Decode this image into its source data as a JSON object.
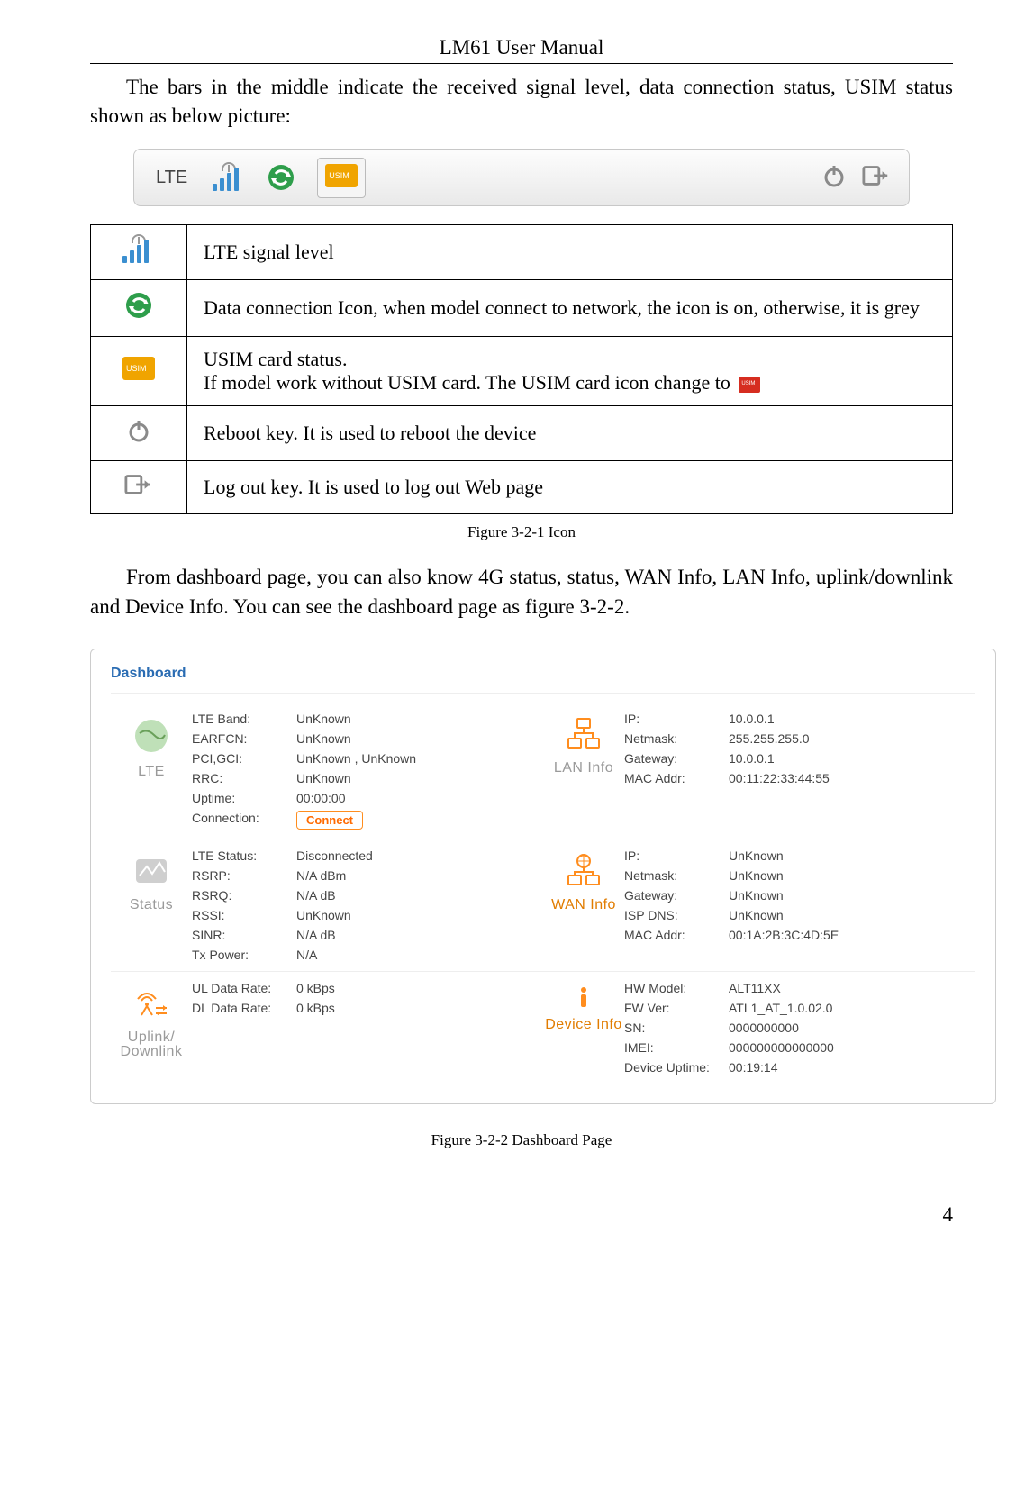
{
  "header": {
    "title": "LM61 User Manual"
  },
  "intro_paragraph": "The bars in the middle indicate the received signal level, data connection status, USIM status shown as below picture:",
  "statusbar": {
    "network_label": "LTE"
  },
  "icon_table": {
    "rows": [
      {
        "desc": "LTE signal level"
      },
      {
        "desc": "Data connection Icon, when model connect to network, the icon is on, otherwise, it is grey"
      },
      {
        "desc_line1": "USIM card status.",
        "desc_line2": "If model work without USIM card. The USIM card icon change to"
      },
      {
        "desc": "Reboot key. It is used to reboot the device"
      },
      {
        "desc": "Log out key. It is used to log out Web page"
      }
    ],
    "caption": "Figure 3-2-1 Icon"
  },
  "middle_paragraph": "From dashboard page, you can also know 4G status, status, WAN Info, LAN Info, uplink/downlink and Device Info. You can see the dashboard page as figure 3-2-2.",
  "dashboard": {
    "title": "Dashboard",
    "lte": {
      "label": "LTE",
      "band_k": "LTE Band:",
      "band_v": "UnKnown",
      "earfcn_k": "EARFCN:",
      "earfcn_v": "UnKnown",
      "pci_k": "PCI,GCI:",
      "pci_v": "UnKnown , UnKnown",
      "rrc_k": "RRC:",
      "rrc_v": "UnKnown",
      "uptime_k": "Uptime:",
      "uptime_v": "00:00:00",
      "conn_k": "Connection:",
      "conn_btn": "Connect"
    },
    "lan": {
      "label": "LAN Info",
      "ip_k": "IP:",
      "ip_v": "10.0.0.1",
      "nm_k": "Netmask:",
      "nm_v": "255.255.255.0",
      "gw_k": "Gateway:",
      "gw_v": "10.0.0.1",
      "mac_k": "MAC Addr:",
      "mac_v": "00:11:22:33:44:55"
    },
    "status": {
      "label": "Status",
      "ltes_k": "LTE Status:",
      "ltes_v": "Disconnected",
      "rsrp_k": "RSRP:",
      "rsrp_v": "N/A dBm",
      "rsrq_k": "RSRQ:",
      "rsrq_v": "N/A dB",
      "rssi_k": "RSSI:",
      "rssi_v": "UnKnown",
      "sinr_k": "SINR:",
      "sinr_v": "N/A dB",
      "txp_k": "Tx Power:",
      "txp_v": "N/A"
    },
    "wan": {
      "label": "WAN Info",
      "ip_k": "IP:",
      "ip_v": "UnKnown",
      "nm_k": "Netmask:",
      "nm_v": "UnKnown",
      "gw_k": "Gateway:",
      "gw_v": "UnKnown",
      "dns_k": "ISP DNS:",
      "dns_v": "UnKnown",
      "mac_k": "MAC Addr:",
      "mac_v": "00:1A:2B:3C:4D:5E"
    },
    "uplink": {
      "label1": "Uplink/",
      "label2": "Downlink",
      "ul_k": "UL Data Rate:",
      "ul_v": "0 kBps",
      "dl_k": "DL Data Rate:",
      "dl_v": "0 kBps"
    },
    "device": {
      "label": "Device Info",
      "hw_k": "HW Model:",
      "hw_v": "ALT11XX",
      "fw_k": "FW Ver:",
      "fw_v": "ATL1_AT_1.0.02.0",
      "sn_k": "SN:",
      "sn_v": "0000000000",
      "imei_k": "IMEI:",
      "imei_v": "000000000000000",
      "up_k": "Device Uptime:",
      "up_v": "00:19:14"
    },
    "caption": "Figure 3-2-2 Dashboard Page"
  },
  "page_number": "4"
}
